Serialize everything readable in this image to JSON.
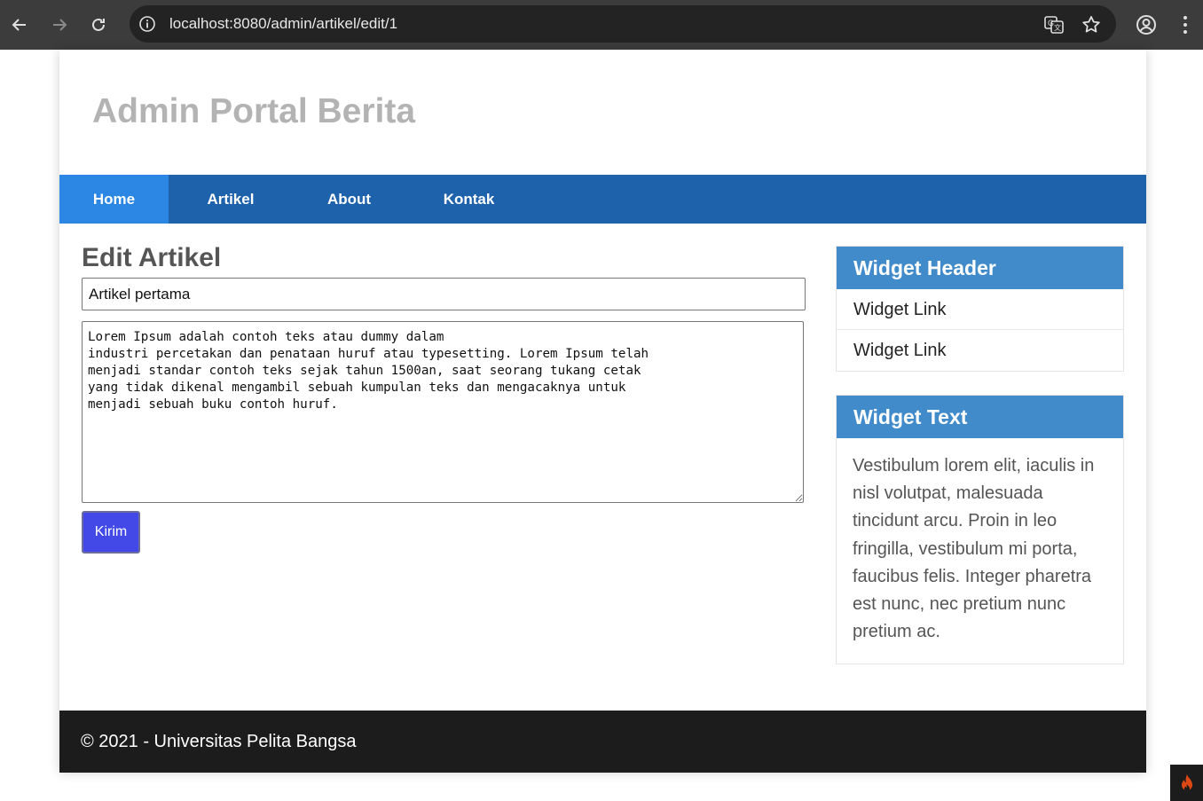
{
  "browser": {
    "url": "localhost:8080/admin/artikel/edit/1"
  },
  "site": {
    "title": "Admin Portal Berita"
  },
  "nav": {
    "items": [
      {
        "label": "Home",
        "active": true
      },
      {
        "label": "Artikel",
        "active": false
      },
      {
        "label": "About",
        "active": false
      },
      {
        "label": "Kontak",
        "active": false
      }
    ]
  },
  "form": {
    "heading": "Edit Artikel",
    "title_value": "Artikel pertama",
    "content_value": "Lorem Ipsum adalah contoh teks atau dummy dalam\nindustri percetakan dan penataan huruf atau typesetting. Lorem Ipsum telah\nmenjadi standar contoh teks sejak tahun 1500an, saat seorang tukang cetak\nyang tidak dikenal mengambil sebuah kumpulan teks dan mengacaknya untuk\nmenjadi sebuah buku contoh huruf.",
    "submit_label": "Kirim"
  },
  "sidebar": {
    "widget1": {
      "header": "Widget Header",
      "links": [
        "Widget Link",
        "Widget Link"
      ]
    },
    "widget2": {
      "header": "Widget Text",
      "text": "Vestibulum lorem elit, iaculis in nisl volutpat, malesuada tincidunt arcu. Proin in leo fringilla, vestibulum mi porta, faucibus felis. Integer pharetra est nunc, nec pretium nunc pretium ac."
    }
  },
  "footer": {
    "text": "© 2021 - Universitas Pelita Bangsa"
  },
  "colors": {
    "navbar": "#1f62ac",
    "nav_active": "#2b86e4",
    "widget_header": "#428bca",
    "submit": "#4349e6",
    "footer": "#1c1c1c"
  }
}
